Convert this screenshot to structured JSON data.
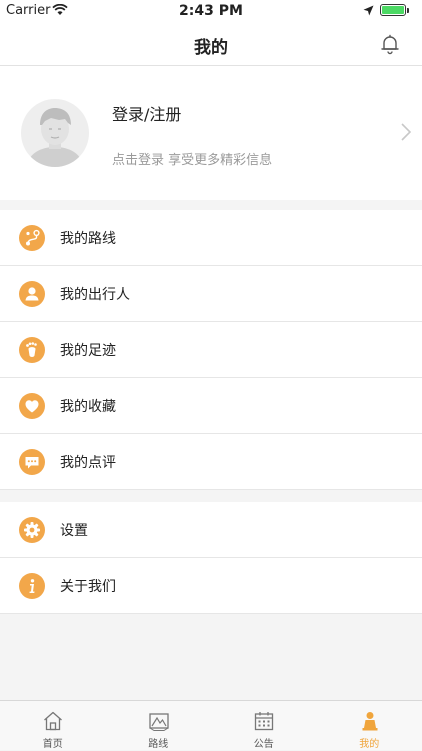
{
  "status_bar": {
    "carrier": "Carrier",
    "time": "2:43 PM",
    "battery_level": 1.0
  },
  "nav": {
    "title": "我的"
  },
  "profile": {
    "login_label": "登录/注册",
    "subtitle": "点击登录  享受更多精彩信息"
  },
  "menu_group_1": [
    {
      "label": "我的路线",
      "icon": "route-icon"
    },
    {
      "label": "我的出行人",
      "icon": "person-icon"
    },
    {
      "label": "我的足迹",
      "icon": "footprint-icon"
    },
    {
      "label": "我的收藏",
      "icon": "heart-icon"
    },
    {
      "label": "我的点评",
      "icon": "comment-icon"
    }
  ],
  "menu_group_2": [
    {
      "label": "设置",
      "icon": "gear-icon"
    },
    {
      "label": "关于我们",
      "icon": "info-icon"
    }
  ],
  "tabs": [
    {
      "label": "首页",
      "icon": "home-icon",
      "active": false
    },
    {
      "label": "路线",
      "icon": "map-icon",
      "active": false
    },
    {
      "label": "公告",
      "icon": "calendar-icon",
      "active": false
    },
    {
      "label": "我的",
      "icon": "user-icon",
      "active": true
    }
  ],
  "colors": {
    "accent": "#f0a53c",
    "icon_circle": "#f2a74a",
    "background": "#f4f4f4"
  }
}
